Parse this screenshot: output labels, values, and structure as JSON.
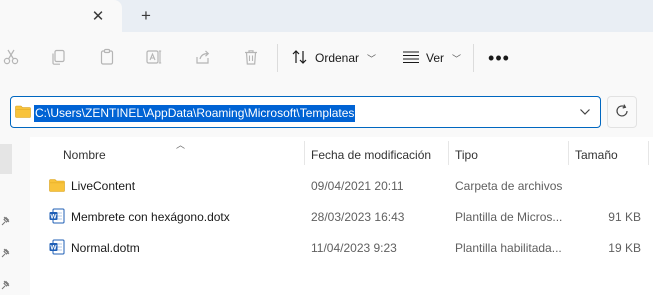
{
  "tabs": {
    "close_glyph": "✕",
    "new_glyph": "+"
  },
  "toolbar": {
    "sort_label": "Ordenar",
    "view_label": "Ver",
    "more_label": "•••",
    "icons": [
      "cut-icon",
      "copy-icon",
      "paste-icon",
      "rename-icon",
      "share-icon",
      "delete-icon"
    ]
  },
  "address": {
    "path": "C:\\Users\\ZENTINEL\\AppData\\Roaming\\Microsoft\\Templates"
  },
  "columns": {
    "name": "Nombre",
    "modified": "Fecha de modificación",
    "type": "Tipo",
    "size": "Tamaño"
  },
  "files": [
    {
      "name": "LiveContent",
      "modified": "09/04/2021 20:11",
      "type": "Carpeta de archivos",
      "size": "",
      "icon": "folder-icon"
    },
    {
      "name": "Membrete con hexágono.dotx",
      "modified": "28/03/2023 16:43",
      "type": "Plantilla de Micros...",
      "size": "91 KB",
      "icon": "word-template-icon"
    },
    {
      "name": "Normal.dotm",
      "modified": "11/04/2023 9:23",
      "type": "Plantilla habilitada...",
      "size": "19 KB",
      "icon": "word-template-icon"
    }
  ],
  "colors": {
    "accent": "#0067c0",
    "selection": "#0063d4",
    "folder": "#f8c33b",
    "word_blue": "#1f5fb6"
  }
}
